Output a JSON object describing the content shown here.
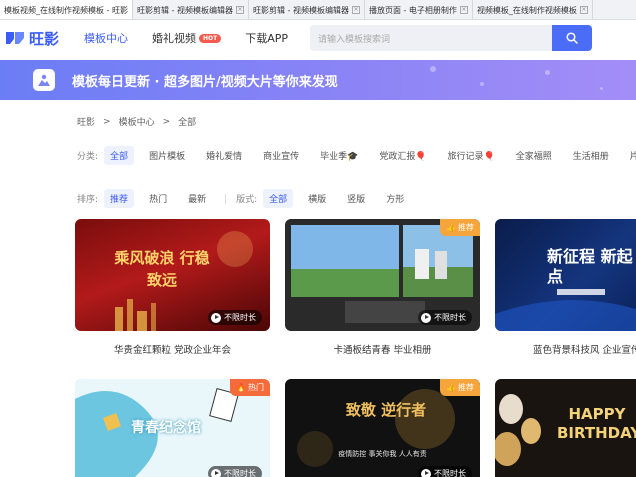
{
  "browser": {
    "tabs": [
      {
        "title": "模板视频_在线制作视频模板 - 旺影",
        "active": true
      },
      {
        "title": "旺影剪辑 - 视频模板编辑器"
      },
      {
        "title": "旺影剪辑 - 视频模板编辑器"
      },
      {
        "title": "播放页面 - 电子相册制作"
      },
      {
        "title": "视频模板_在线制作视频模板"
      }
    ]
  },
  "header": {
    "logo_text": "旺影",
    "nav": [
      {
        "label": "模板中心",
        "active": true
      },
      {
        "label": "婚礼视频",
        "badge": "HOT"
      },
      {
        "label": "下载APP"
      }
    ],
    "search_placeholder": "请输入模板搜索词"
  },
  "banner": {
    "text": "模板每日更新 · 超多图片/视频大片等你来发现"
  },
  "breadcrumb": [
    "旺影",
    ">",
    "模板中心",
    ">",
    "全部"
  ],
  "filters": {
    "category_label": "分类:",
    "categories": [
      "全部",
      "图片模板",
      "婚礼爱情",
      "商业宣传",
      "毕业季🎓",
      "党政汇报🎈",
      "旅行记录🎈",
      "全家福照",
      "生活相册",
      "片头片尾"
    ],
    "sort_label": "排序:",
    "sorts": [
      "推荐",
      "热门",
      "最新"
    ],
    "format_label": "版式:",
    "formats": [
      "全部",
      "横版",
      "竖版",
      "方形"
    ]
  },
  "cards": [
    {
      "title": "华贵金红颗粒 党政企业年会",
      "duration": "不限时长",
      "art": "乘风破浪 行稳致远"
    },
    {
      "title": "卡通板结青春 毕业相册",
      "duration": "不限时长",
      "tag": "推荐"
    },
    {
      "title": "蓝色背景科技风 企业宣传",
      "art": "新征程 新起点"
    },
    {
      "title": "",
      "duration": "不限时长",
      "tag": "热门",
      "art": "青春纪念馆"
    },
    {
      "title": "",
      "duration": "不限时长",
      "tag": "推荐",
      "art": "致敬 逆行者",
      "art_sub": "疫情防控 事关你我 人人有责"
    },
    {
      "title": "",
      "art": "HAPPY BIRTHDAY"
    }
  ],
  "colors": {
    "brand": "#3b5cf5",
    "hot": "#f55a4e",
    "recommend": "#f5a53b"
  }
}
